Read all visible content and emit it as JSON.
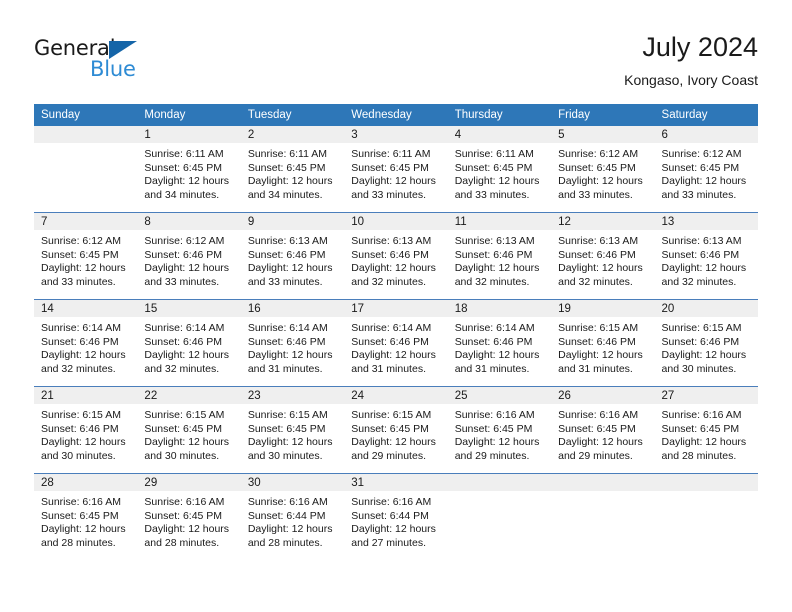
{
  "logo": {
    "word1": "General",
    "word2": "Blue",
    "triangle_color": "#1565a8",
    "blue_color": "#2e8bd4"
  },
  "header": {
    "title": "July 2024",
    "subtitle": "Kongaso, Ivory Coast"
  },
  "theme": {
    "header_blue": "#2e77b8",
    "daynum_band": "#efefef",
    "week_separator": "#4a7ebb"
  },
  "weekdays": [
    "Sunday",
    "Monday",
    "Tuesday",
    "Wednesday",
    "Thursday",
    "Friday",
    "Saturday"
  ],
  "weeks": [
    [
      {
        "day": "",
        "lines": []
      },
      {
        "day": "1",
        "lines": [
          "Sunrise: 6:11 AM",
          "Sunset: 6:45 PM",
          "Daylight: 12 hours",
          "and 34 minutes."
        ]
      },
      {
        "day": "2",
        "lines": [
          "Sunrise: 6:11 AM",
          "Sunset: 6:45 PM",
          "Daylight: 12 hours",
          "and 34 minutes."
        ]
      },
      {
        "day": "3",
        "lines": [
          "Sunrise: 6:11 AM",
          "Sunset: 6:45 PM",
          "Daylight: 12 hours",
          "and 33 minutes."
        ]
      },
      {
        "day": "4",
        "lines": [
          "Sunrise: 6:11 AM",
          "Sunset: 6:45 PM",
          "Daylight: 12 hours",
          "and 33 minutes."
        ]
      },
      {
        "day": "5",
        "lines": [
          "Sunrise: 6:12 AM",
          "Sunset: 6:45 PM",
          "Daylight: 12 hours",
          "and 33 minutes."
        ]
      },
      {
        "day": "6",
        "lines": [
          "Sunrise: 6:12 AM",
          "Sunset: 6:45 PM",
          "Daylight: 12 hours",
          "and 33 minutes."
        ]
      }
    ],
    [
      {
        "day": "7",
        "lines": [
          "Sunrise: 6:12 AM",
          "Sunset: 6:45 PM",
          "Daylight: 12 hours",
          "and 33 minutes."
        ]
      },
      {
        "day": "8",
        "lines": [
          "Sunrise: 6:12 AM",
          "Sunset: 6:46 PM",
          "Daylight: 12 hours",
          "and 33 minutes."
        ]
      },
      {
        "day": "9",
        "lines": [
          "Sunrise: 6:13 AM",
          "Sunset: 6:46 PM",
          "Daylight: 12 hours",
          "and 33 minutes."
        ]
      },
      {
        "day": "10",
        "lines": [
          "Sunrise: 6:13 AM",
          "Sunset: 6:46 PM",
          "Daylight: 12 hours",
          "and 32 minutes."
        ]
      },
      {
        "day": "11",
        "lines": [
          "Sunrise: 6:13 AM",
          "Sunset: 6:46 PM",
          "Daylight: 12 hours",
          "and 32 minutes."
        ]
      },
      {
        "day": "12",
        "lines": [
          "Sunrise: 6:13 AM",
          "Sunset: 6:46 PM",
          "Daylight: 12 hours",
          "and 32 minutes."
        ]
      },
      {
        "day": "13",
        "lines": [
          "Sunrise: 6:13 AM",
          "Sunset: 6:46 PM",
          "Daylight: 12 hours",
          "and 32 minutes."
        ]
      }
    ],
    [
      {
        "day": "14",
        "lines": [
          "Sunrise: 6:14 AM",
          "Sunset: 6:46 PM",
          "Daylight: 12 hours",
          "and 32 minutes."
        ]
      },
      {
        "day": "15",
        "lines": [
          "Sunrise: 6:14 AM",
          "Sunset: 6:46 PM",
          "Daylight: 12 hours",
          "and 32 minutes."
        ]
      },
      {
        "day": "16",
        "lines": [
          "Sunrise: 6:14 AM",
          "Sunset: 6:46 PM",
          "Daylight: 12 hours",
          "and 31 minutes."
        ]
      },
      {
        "day": "17",
        "lines": [
          "Sunrise: 6:14 AM",
          "Sunset: 6:46 PM",
          "Daylight: 12 hours",
          "and 31 minutes."
        ]
      },
      {
        "day": "18",
        "lines": [
          "Sunrise: 6:14 AM",
          "Sunset: 6:46 PM",
          "Daylight: 12 hours",
          "and 31 minutes."
        ]
      },
      {
        "day": "19",
        "lines": [
          "Sunrise: 6:15 AM",
          "Sunset: 6:46 PM",
          "Daylight: 12 hours",
          "and 31 minutes."
        ]
      },
      {
        "day": "20",
        "lines": [
          "Sunrise: 6:15 AM",
          "Sunset: 6:46 PM",
          "Daylight: 12 hours",
          "and 30 minutes."
        ]
      }
    ],
    [
      {
        "day": "21",
        "lines": [
          "Sunrise: 6:15 AM",
          "Sunset: 6:46 PM",
          "Daylight: 12 hours",
          "and 30 minutes."
        ]
      },
      {
        "day": "22",
        "lines": [
          "Sunrise: 6:15 AM",
          "Sunset: 6:45 PM",
          "Daylight: 12 hours",
          "and 30 minutes."
        ]
      },
      {
        "day": "23",
        "lines": [
          "Sunrise: 6:15 AM",
          "Sunset: 6:45 PM",
          "Daylight: 12 hours",
          "and 30 minutes."
        ]
      },
      {
        "day": "24",
        "lines": [
          "Sunrise: 6:15 AM",
          "Sunset: 6:45 PM",
          "Daylight: 12 hours",
          "and 29 minutes."
        ]
      },
      {
        "day": "25",
        "lines": [
          "Sunrise: 6:16 AM",
          "Sunset: 6:45 PM",
          "Daylight: 12 hours",
          "and 29 minutes."
        ]
      },
      {
        "day": "26",
        "lines": [
          "Sunrise: 6:16 AM",
          "Sunset: 6:45 PM",
          "Daylight: 12 hours",
          "and 29 minutes."
        ]
      },
      {
        "day": "27",
        "lines": [
          "Sunrise: 6:16 AM",
          "Sunset: 6:45 PM",
          "Daylight: 12 hours",
          "and 28 minutes."
        ]
      }
    ],
    [
      {
        "day": "28",
        "lines": [
          "Sunrise: 6:16 AM",
          "Sunset: 6:45 PM",
          "Daylight: 12 hours",
          "and 28 minutes."
        ]
      },
      {
        "day": "29",
        "lines": [
          "Sunrise: 6:16 AM",
          "Sunset: 6:45 PM",
          "Daylight: 12 hours",
          "and 28 minutes."
        ]
      },
      {
        "day": "30",
        "lines": [
          "Sunrise: 6:16 AM",
          "Sunset: 6:44 PM",
          "Daylight: 12 hours",
          "and 28 minutes."
        ]
      },
      {
        "day": "31",
        "lines": [
          "Sunrise: 6:16 AM",
          "Sunset: 6:44 PM",
          "Daylight: 12 hours",
          "and 27 minutes."
        ]
      },
      {
        "day": "",
        "lines": []
      },
      {
        "day": "",
        "lines": []
      },
      {
        "day": "",
        "lines": []
      }
    ]
  ]
}
